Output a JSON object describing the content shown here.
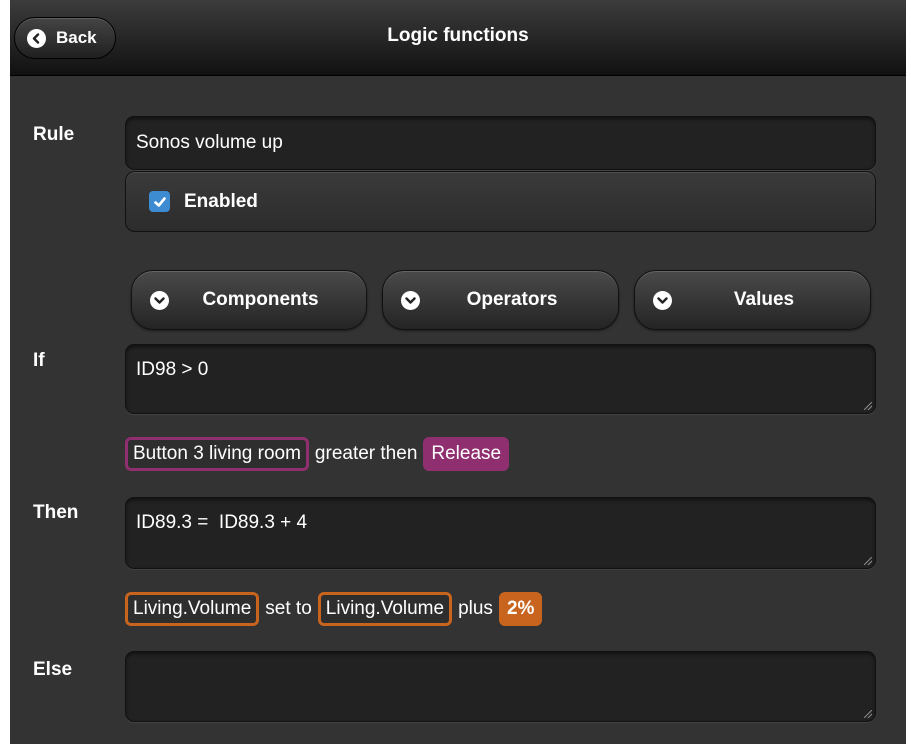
{
  "header": {
    "title": "Logic functions",
    "back_label": "Back"
  },
  "rule": {
    "label": "Rule",
    "value": "Sonos volume up",
    "enabled_label": "Enabled",
    "enabled": true
  },
  "dropdowns": [
    {
      "label": "Components"
    },
    {
      "label": "Operators"
    },
    {
      "label": "Values"
    }
  ],
  "if_section": {
    "label": "If",
    "expression": "ID98 > 0",
    "tokens": [
      {
        "text": "Button 3 living room"
      },
      {
        "text": "greater then"
      },
      {
        "text": "Release"
      }
    ]
  },
  "then_section": {
    "label": "Then",
    "expression": "ID89.3 =  ID89.3 + 4",
    "tokens": [
      {
        "text": "Living.Volume"
      },
      {
        "text": "set to"
      },
      {
        "text": "Living.Volume"
      },
      {
        "text": "plus"
      },
      {
        "text": "2%"
      }
    ]
  },
  "else_section": {
    "label": "Else",
    "expression": ""
  },
  "colors": {
    "background": "#333333",
    "checkbox": "#3d8bd1",
    "if_token": "#8f2f6f",
    "then_token": "#c8641e"
  }
}
